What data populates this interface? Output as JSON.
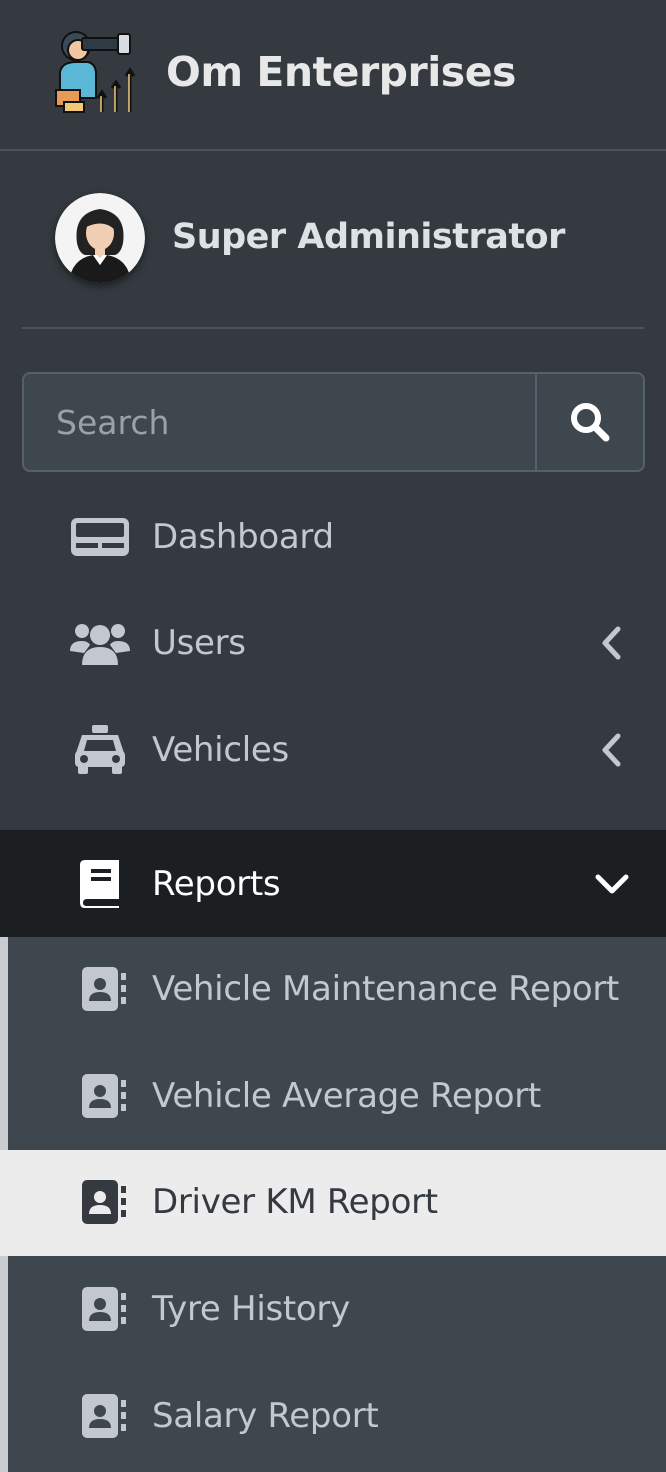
{
  "brand": {
    "name": "Om Enterprises"
  },
  "user": {
    "name": "Super Administrator"
  },
  "search": {
    "placeholder": "Search"
  },
  "nav": {
    "items": [
      {
        "label": "Dashboard",
        "icon": "id-card-icon"
      },
      {
        "label": "Users",
        "icon": "users-icon"
      },
      {
        "label": "Vehicles",
        "icon": "taxi-icon"
      },
      {
        "label": "Reports",
        "icon": "book-icon"
      }
    ],
    "reports_sub": [
      {
        "label": "Vehicle Maintenance Report"
      },
      {
        "label": "Vehicle Average Report"
      },
      {
        "label": "Driver KM Report"
      },
      {
        "label": "Tyre History"
      },
      {
        "label": "Salary Report"
      }
    ]
  },
  "colors": {
    "sidebar_bg": "#343a40",
    "active_bg": "#1c1f22",
    "submenu_bg": "#3f474e",
    "selected_bg": "#ececec",
    "text": "#c2c7d0"
  }
}
